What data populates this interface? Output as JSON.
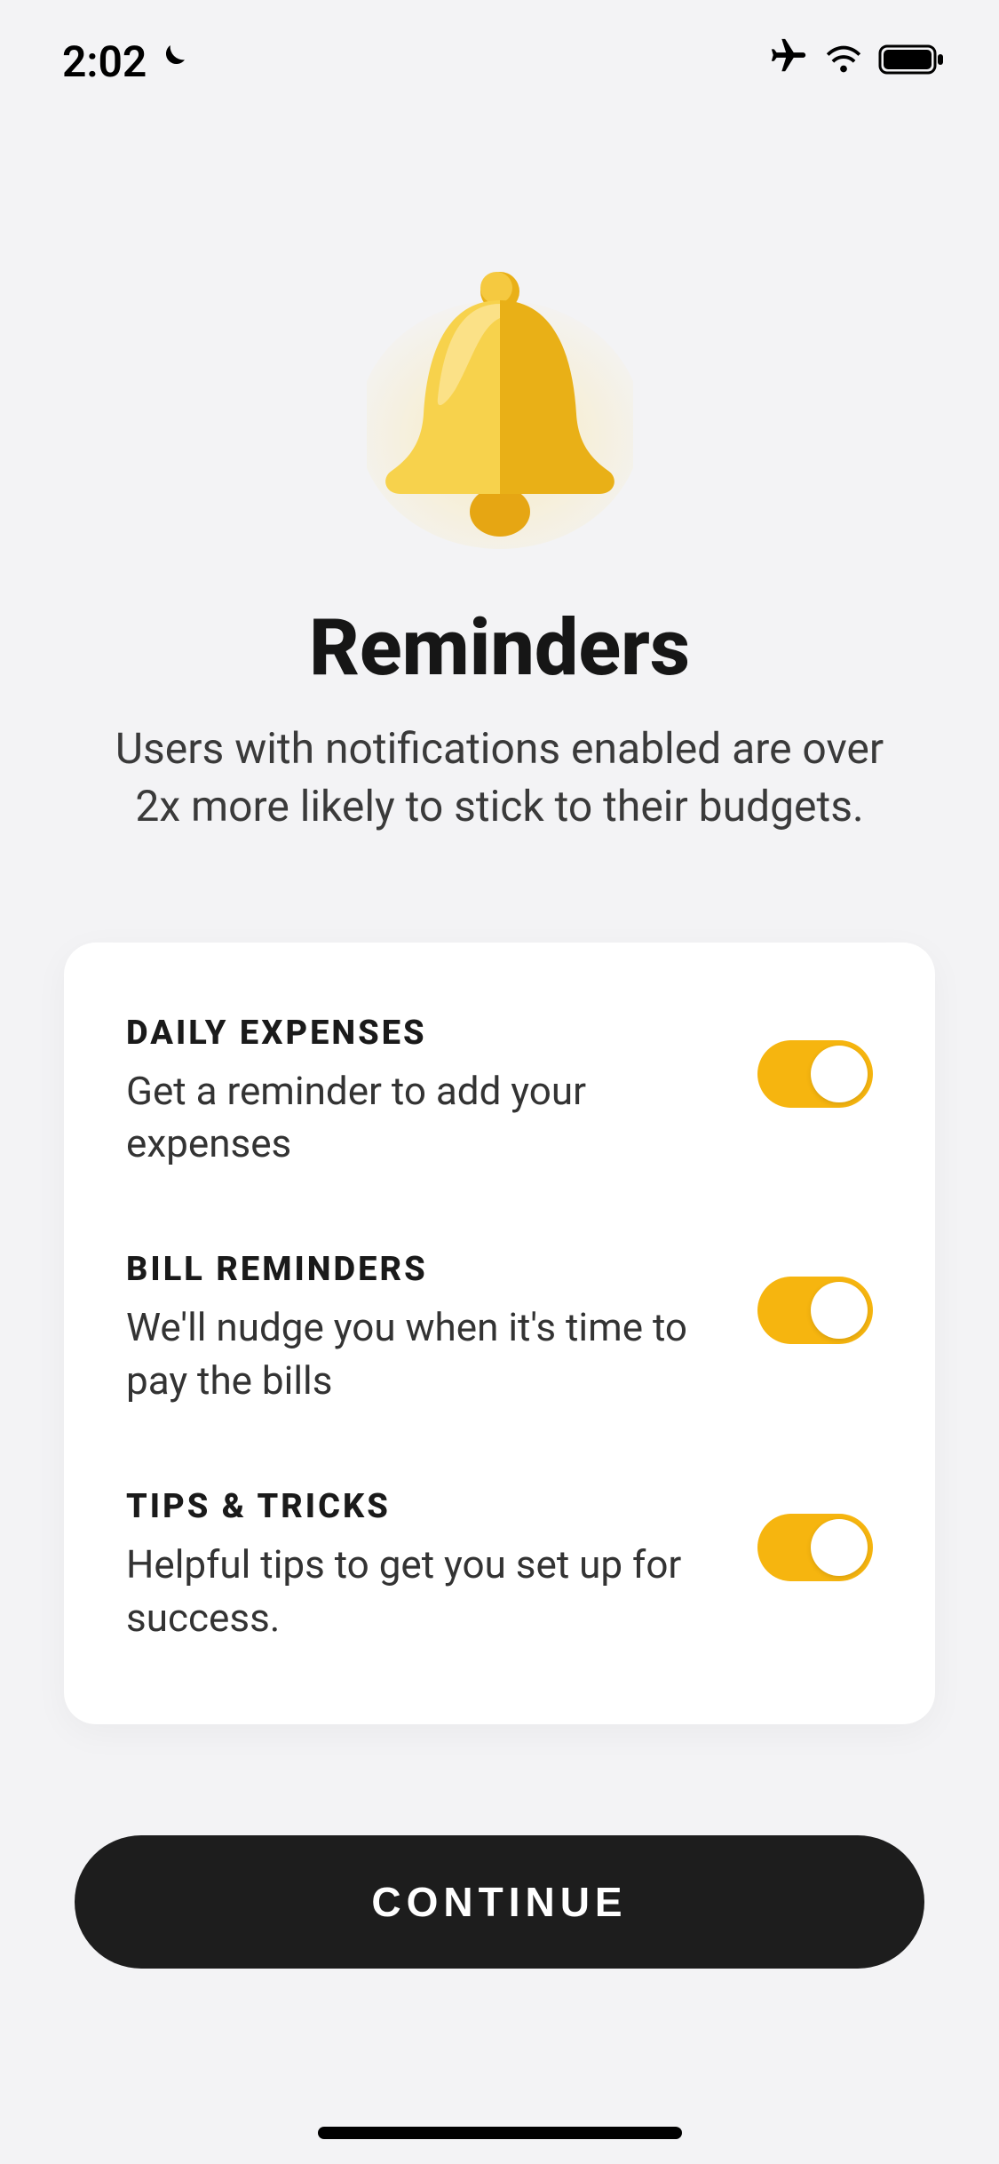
{
  "status_bar": {
    "time": "2:02"
  },
  "hero": {
    "title": "Reminders",
    "subtitle": "Users with notifications enabled are over 2x more likely to stick to their budgets."
  },
  "settings": [
    {
      "title": "DAILY EXPENSES",
      "desc": "Get a reminder to add your expenses",
      "on": true
    },
    {
      "title": "BILL REMINDERS",
      "desc": "We'll nudge you when it's time to pay the bills",
      "on": true
    },
    {
      "title": "TIPS & TRICKS",
      "desc": "Helpful tips to get you set up for success.",
      "on": true
    }
  ],
  "cta": {
    "label": "CONTINUE"
  }
}
